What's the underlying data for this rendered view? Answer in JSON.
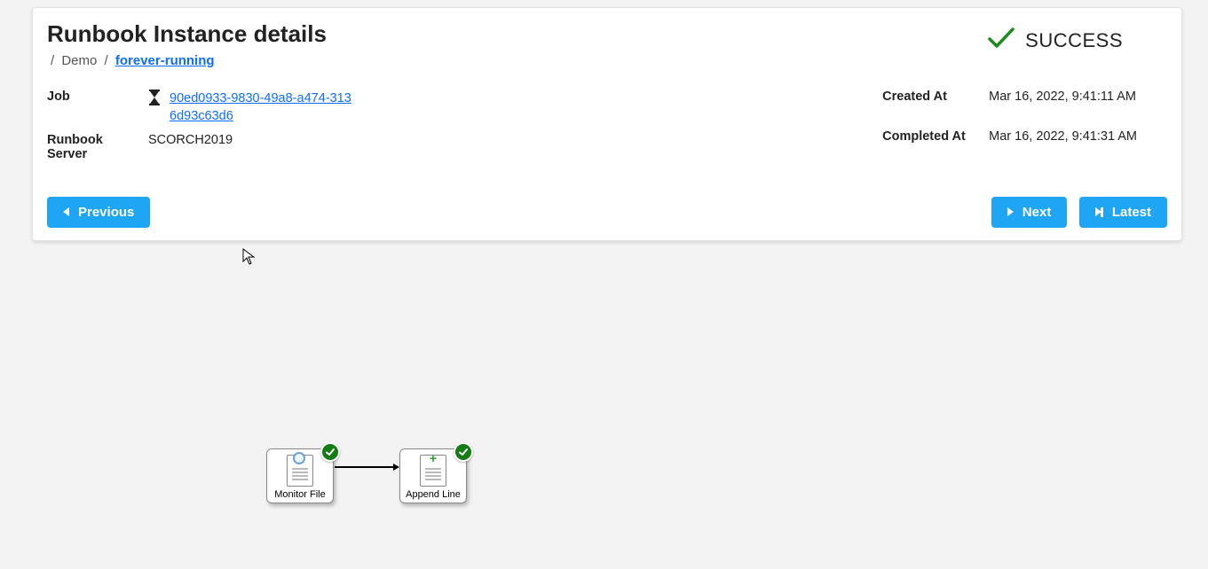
{
  "page": {
    "title": "Runbook Instance details"
  },
  "breadcrumb": {
    "items": [
      "Demo",
      "forever-running"
    ]
  },
  "status": {
    "text": "SUCCESS",
    "color": "#1f8a1f"
  },
  "details_left": {
    "job_label": "Job",
    "job_id": "90ed0933-9830-49a8-a474-3136d93c63d6",
    "runbook_server_label": "Runbook Server",
    "runbook_server_value": "SCORCH2019"
  },
  "details_right": {
    "created_label": "Created At",
    "created_value": "Mar 16, 2022, 9:41:11 AM",
    "completed_label": "Completed At",
    "completed_value": "Mar 16, 2022, 9:41:31 AM"
  },
  "buttons": {
    "previous": "Previous",
    "next": "Next",
    "latest": "Latest"
  },
  "diagram": {
    "nodes": [
      {
        "label": "Monitor File",
        "type": "monitor",
        "status": "success"
      },
      {
        "label": "Append Line",
        "type": "append",
        "status": "success"
      }
    ]
  }
}
